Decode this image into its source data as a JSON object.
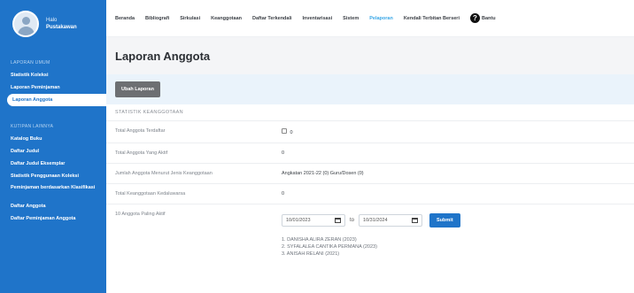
{
  "user": {
    "greeting": "Halo",
    "name": "Pustakawan"
  },
  "sidebar": {
    "headings": [
      "LAPORAN UMUM",
      "KUTIPAN LAINNYA"
    ],
    "report_items": [
      "Statistik Koleksi",
      "Laporan Peminjaman",
      "Laporan Anggota"
    ],
    "other_items": [
      "Katalog Buku",
      "Daftar Judul",
      "Daftar Judul Eksemplar",
      "Statistik Penggunaan Koleksi",
      "Peminjaman berdasarkan Klasifikasi",
      "Daftar Anggota",
      "Daftar Peminjaman Anggota"
    ]
  },
  "topnav": {
    "items": [
      "Beranda",
      "Bibliografi",
      "Sirkulasi",
      "Keanggotaan",
      "Daftar Terkendali",
      "Inventarisasi",
      "Sistem",
      "Pelaporan",
      "Kendali Terbitan Berseri"
    ],
    "active": "Pelaporan",
    "help_label": "Bantu"
  },
  "page": {
    "title": "Laporan Anggota",
    "change_button": "Ubah Laporan",
    "section_title": "STATISTIK KEANGGOTAAN"
  },
  "stats": {
    "rows": [
      {
        "label": "Total Anggota Terdaftar",
        "value": "0"
      },
      {
        "label": "Total Anggota Yang Aktif",
        "value": "0"
      },
      {
        "label": "Jumlah Anggota Menurut Jenis Keanggotaan",
        "value": "Angkatan 2021-22 (0) Guru/Dosen (0)"
      },
      {
        "label": "Total Keanggotaan Kedaluwarsa",
        "value": "0"
      },
      {
        "label": "10 Anggota Paling Aktif",
        "value": ""
      }
    ],
    "date_from": "10/01/2023",
    "date_separator": "to",
    "date_to": "10/31/2024",
    "submit_label": "Submit",
    "top_members": [
      "1. DANISHA ALIRA ZERAN (2023)",
      "2. SYFALALEA CANTIKA PERMANA (2023)",
      "3. ANISAH RELANI (2021)"
    ]
  }
}
